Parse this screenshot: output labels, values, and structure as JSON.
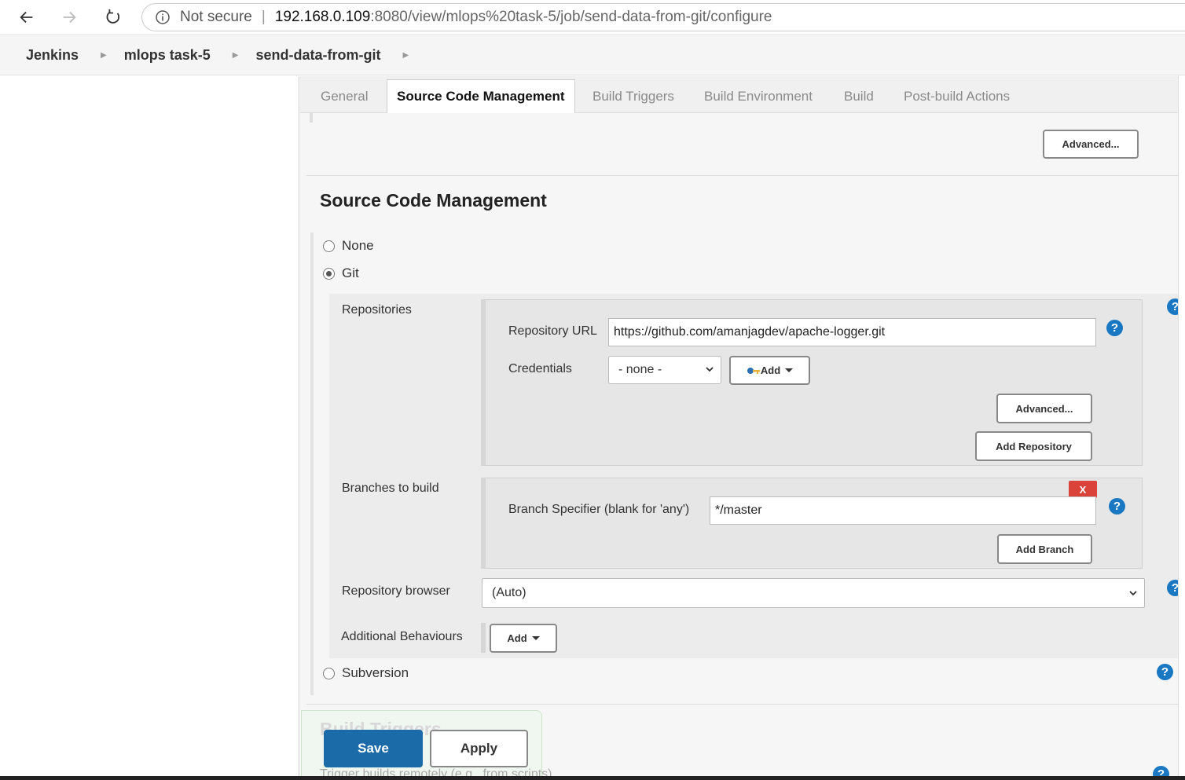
{
  "browser": {
    "not_secure": "Not secure",
    "separator": "|",
    "url_host": "192.168.0.109",
    "url_rest": ":8080/view/mlops%20task-5/job/send-data-from-git/configure"
  },
  "breadcrumb": [
    "Jenkins",
    "mlops task-5",
    "send-data-from-git"
  ],
  "tabs": [
    "General",
    "Source Code Management",
    "Build Triggers",
    "Build Environment",
    "Build",
    "Post-build Actions"
  ],
  "active_tab": "Source Code Management",
  "top_advanced_label": "Advanced...",
  "scm": {
    "title": "Source Code Management",
    "options": {
      "none": "None",
      "git": "Git",
      "subversion": "Subversion"
    },
    "selected": "Git",
    "repositories_label": "Repositories",
    "repo_url_label": "Repository URL",
    "repo_url_value": "https://github.com/amanjagdev/apache-logger.git",
    "credentials_label": "Credentials",
    "credentials_value": "- none -",
    "add_label": "Add",
    "advanced_label": "Advanced...",
    "add_repository_label": "Add Repository",
    "branches_label": "Branches to build",
    "delete_label": "X",
    "branch_spec_label": "Branch Specifier (blank for 'any')",
    "branch_spec_value": "*/master",
    "add_branch_label": "Add Branch",
    "repo_browser_label": "Repository browser",
    "repo_browser_value": "(Auto)",
    "additional_behaviours_label": "Additional Behaviours",
    "additional_add_label": "Add"
  },
  "help_glyph": "?",
  "next_section_title": "Build Triggers",
  "next_section_line": "Trigger builds remotely (e.g., from scripts)",
  "footer": {
    "save_label": "Save",
    "apply_label": "Apply"
  }
}
